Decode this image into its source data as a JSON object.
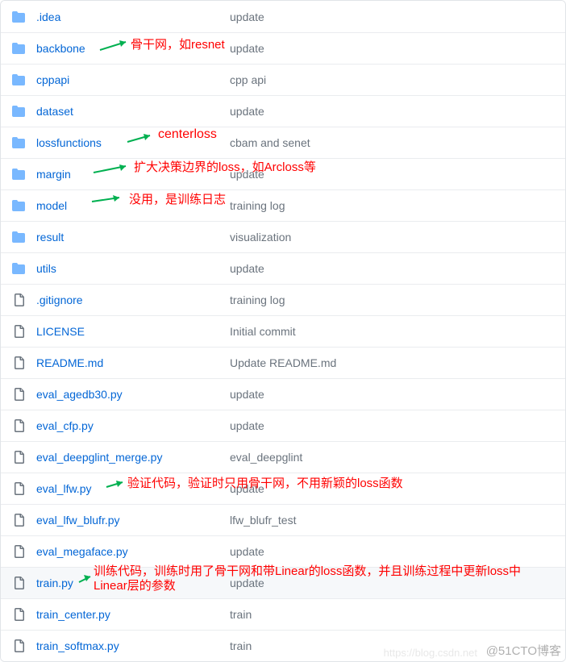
{
  "files": [
    {
      "name": ".idea",
      "type": "folder",
      "commit": "update"
    },
    {
      "name": "backbone",
      "type": "folder",
      "commit": "update"
    },
    {
      "name": "cppapi",
      "type": "folder",
      "commit": "cpp api"
    },
    {
      "name": "dataset",
      "type": "folder",
      "commit": "update"
    },
    {
      "name": "lossfunctions",
      "type": "folder",
      "commit": "cbam and senet"
    },
    {
      "name": "margin",
      "type": "folder",
      "commit": "update"
    },
    {
      "name": "model",
      "type": "folder",
      "commit": "training log"
    },
    {
      "name": "result",
      "type": "folder",
      "commit": "visualization"
    },
    {
      "name": "utils",
      "type": "folder",
      "commit": "update"
    },
    {
      "name": ".gitignore",
      "type": "file",
      "commit": "training log"
    },
    {
      "name": "LICENSE",
      "type": "file",
      "commit": "Initial commit"
    },
    {
      "name": "README.md",
      "type": "file",
      "commit": "Update README.md"
    },
    {
      "name": "eval_agedb30.py",
      "type": "file",
      "commit": "update"
    },
    {
      "name": "eval_cfp.py",
      "type": "file",
      "commit": "update"
    },
    {
      "name": "eval_deepglint_merge.py",
      "type": "file",
      "commit": "eval_deepglint"
    },
    {
      "name": "eval_lfw.py",
      "type": "file",
      "commit": "update"
    },
    {
      "name": "eval_lfw_blufr.py",
      "type": "file",
      "commit": "lfw_blufr_test"
    },
    {
      "name": "eval_megaface.py",
      "type": "file",
      "commit": "update"
    },
    {
      "name": "train.py",
      "type": "file",
      "commit": "update",
      "hover": true
    },
    {
      "name": "train_center.py",
      "type": "file",
      "commit": "train"
    },
    {
      "name": "train_softmax.py",
      "type": "file",
      "commit": "train"
    }
  ],
  "annotations": {
    "backbone": "骨干网，如resnet",
    "lossfunctions": "centerloss",
    "margin": "扩大决策边界的loss，如Arcloss等",
    "model": "没用，是训练日志",
    "eval_lfw": "验证代码，验证时只用骨干网，不用新颖的loss函数",
    "train_line1": "训练代码，训练时用了骨干网和带Linear的loss函数，并且训练过程中更新loss中",
    "train_line2": "Linear层的参数"
  },
  "watermark": "@51CTO博客",
  "watermark2": "https://blog.csdn.net"
}
